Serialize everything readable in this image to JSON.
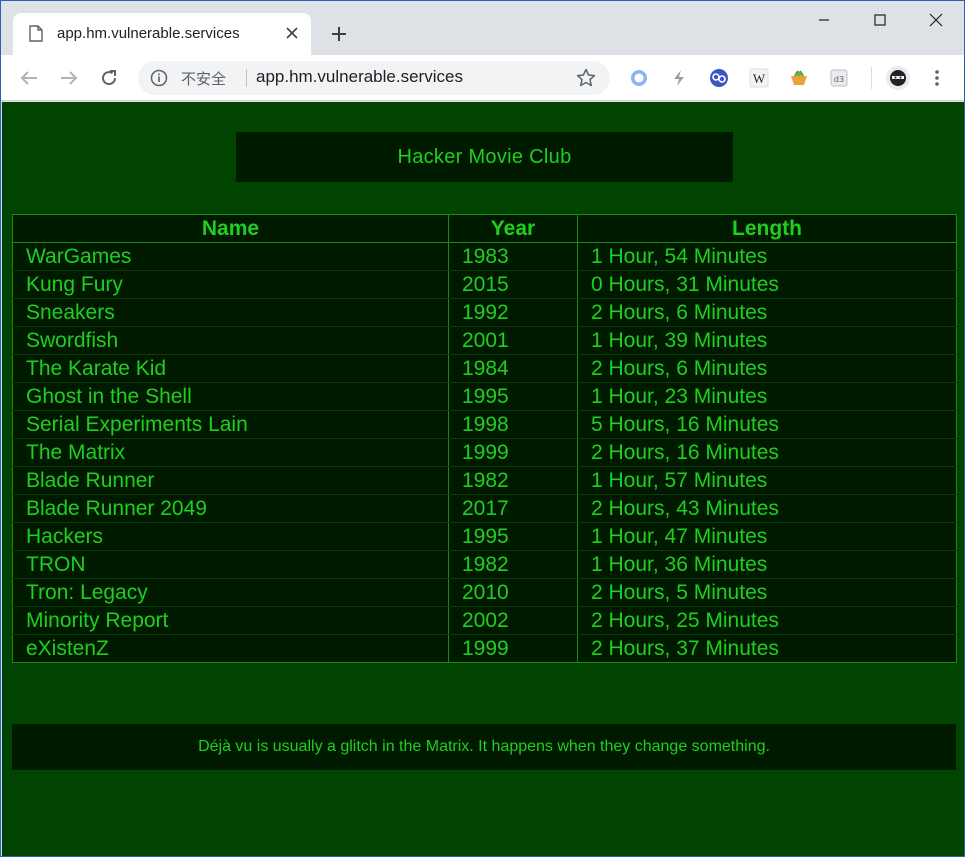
{
  "browser": {
    "tab_title": "app.hm.vulnerable.services",
    "security_label": "不安全",
    "url": "app.hm.vulnerable.services"
  },
  "colors": {
    "page_bg": "#004400",
    "panel_bg": "#001a00",
    "text": "#1fcf1f",
    "border": "#1a8a1a"
  },
  "header": {
    "title": "Hacker Movie Club"
  },
  "table": {
    "columns": [
      "Name",
      "Year",
      "Length"
    ],
    "rows": [
      {
        "name": "WarGames",
        "year": "1983",
        "length": "1 Hour, 54 Minutes"
      },
      {
        "name": "Kung Fury",
        "year": "2015",
        "length": "0 Hours, 31 Minutes"
      },
      {
        "name": "Sneakers",
        "year": "1992",
        "length": "2 Hours, 6 Minutes"
      },
      {
        "name": "Swordfish",
        "year": "2001",
        "length": "1 Hour, 39 Minutes"
      },
      {
        "name": "The Karate Kid",
        "year": "1984",
        "length": "2 Hours, 6 Minutes"
      },
      {
        "name": "Ghost in the Shell",
        "year": "1995",
        "length": "1 Hour, 23 Minutes"
      },
      {
        "name": "Serial Experiments Lain",
        "year": "1998",
        "length": "5 Hours, 16 Minutes"
      },
      {
        "name": "The Matrix",
        "year": "1999",
        "length": "2 Hours, 16 Minutes"
      },
      {
        "name": "Blade Runner",
        "year": "1982",
        "length": "1 Hour, 57 Minutes"
      },
      {
        "name": "Blade Runner 2049",
        "year": "2017",
        "length": "2 Hours, 43 Minutes"
      },
      {
        "name": "Hackers",
        "year": "1995",
        "length": "1 Hour, 47 Minutes"
      },
      {
        "name": "TRON",
        "year": "1982",
        "length": "1 Hour, 36 Minutes"
      },
      {
        "name": "Tron: Legacy",
        "year": "2010",
        "length": "2 Hours, 5 Minutes"
      },
      {
        "name": "Minority Report",
        "year": "2002",
        "length": "2 Hours, 25 Minutes"
      },
      {
        "name": "eXistenZ",
        "year": "1999",
        "length": "2 Hours, 37 Minutes"
      }
    ]
  },
  "footer": {
    "quote": "Déjà vu is usually a glitch in the Matrix. It happens when they change something."
  }
}
